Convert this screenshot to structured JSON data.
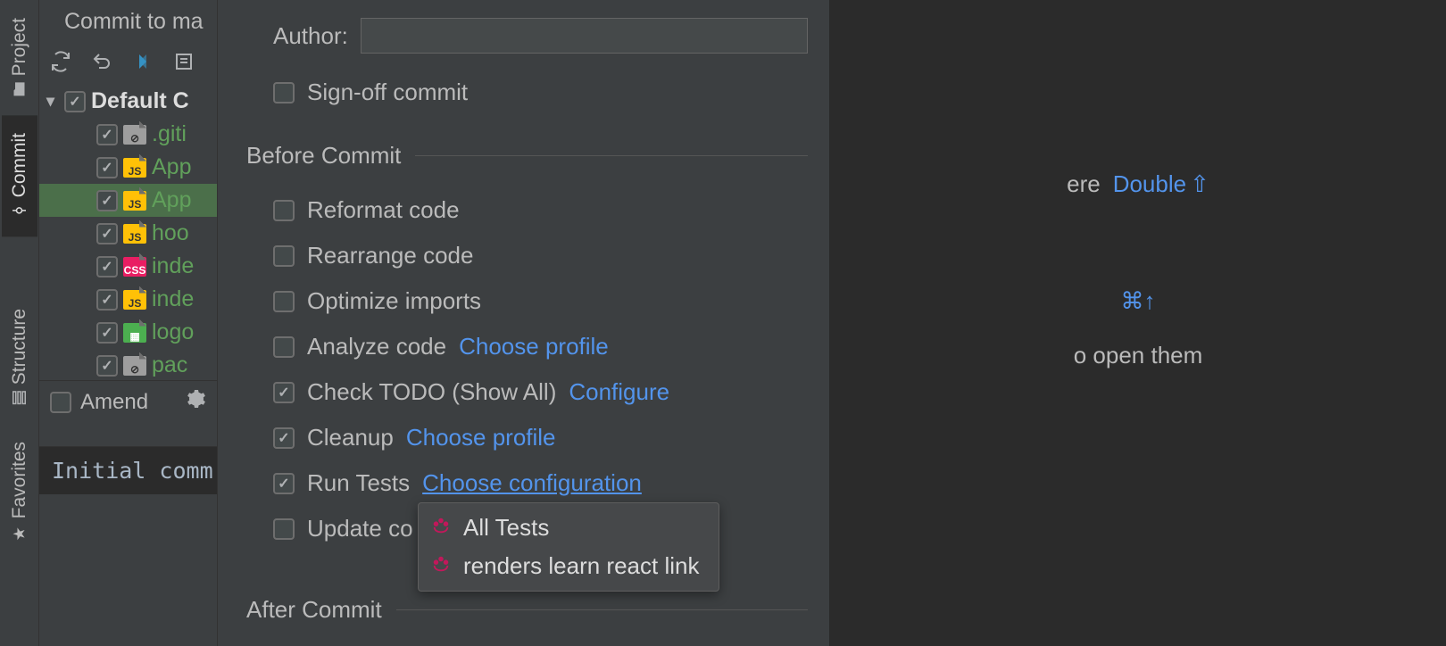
{
  "rail": {
    "project": "Project",
    "commit": "Commit",
    "structure": "Structure",
    "favorites": "Favorites"
  },
  "commitPanel": {
    "title": "Commit to ma",
    "changelist": "Default C",
    "files": [
      {
        "name": ".giti",
        "icon": "gitignore"
      },
      {
        "name": "App",
        "icon": "js"
      },
      {
        "name": "App",
        "icon": "js",
        "selected": true
      },
      {
        "name": "hoo",
        "icon": "js"
      },
      {
        "name": "inde",
        "icon": "css"
      },
      {
        "name": "inde",
        "icon": "js"
      },
      {
        "name": "logo",
        "icon": "img"
      },
      {
        "name": "pac",
        "icon": "gitignore"
      }
    ],
    "amend": "Amend",
    "message": "Initial comm"
  },
  "options": {
    "authorLabel": "Author:",
    "signoff": "Sign-off commit",
    "beforeCommit": "Before Commit",
    "reformat": "Reformat code",
    "rearrange": "Rearrange code",
    "optimize": "Optimize imports",
    "analyze": "Analyze code",
    "analyzeLink": "Choose profile",
    "checkTodo": "Check TODO (Show All)",
    "checkTodoLink": "Configure",
    "cleanup": "Cleanup",
    "cleanupLink": "Choose profile",
    "runTests": "Run Tests",
    "runTestsLink": "Choose configuration",
    "updateCopyright": "Update co",
    "afterCommit": "After Commit"
  },
  "dropdown": {
    "allTests": "All Tests",
    "rendersLink": "renders learn react link"
  },
  "editor": {
    "hint1a": "ere",
    "hint1b": "Double",
    "hint1c": "⇧",
    "hint2a": "⌘↑",
    "hint3": "o open them"
  }
}
